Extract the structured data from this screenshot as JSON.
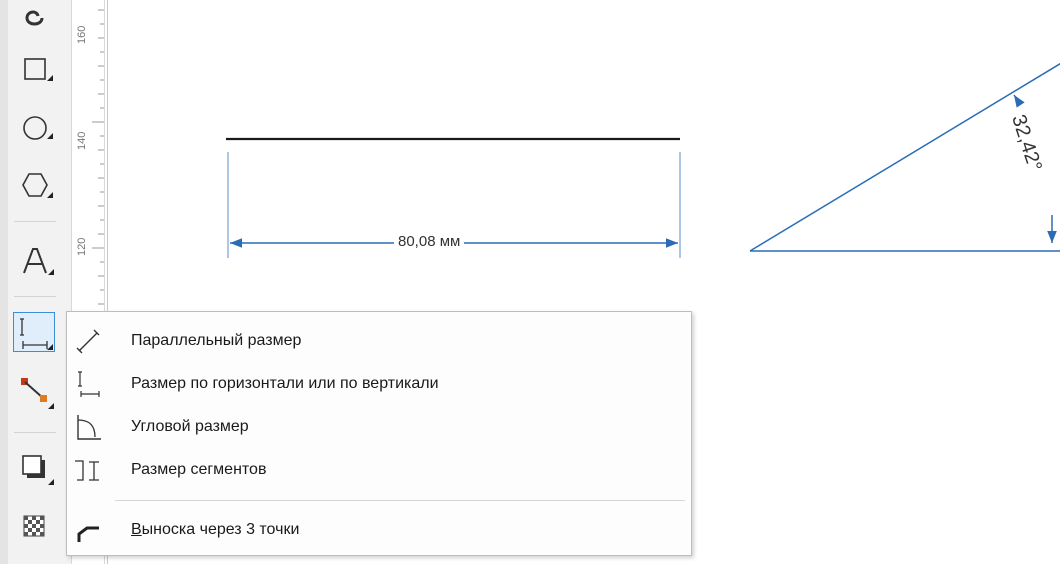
{
  "toolbox": {
    "tools": [
      {
        "name": "spiral-tool-icon"
      },
      {
        "name": "rectangle-tool-icon"
      },
      {
        "name": "ellipse-tool-icon"
      },
      {
        "name": "polygon-tool-icon"
      },
      {
        "name": "text-tool-icon"
      },
      {
        "name": "dimension-tool-icon",
        "active": true
      },
      {
        "name": "connector-tool-icon"
      },
      {
        "name": "drop-shadow-tool-icon"
      },
      {
        "name": "transparency-tool-icon"
      }
    ],
    "active_color": "#3b8fd6"
  },
  "ruler": {
    "labels": [
      "160",
      "140",
      "120"
    ]
  },
  "canvas": {
    "linear_dimension_text": "80,08 мм",
    "angular_dimension_text": "32,42°",
    "dimension_color": "#2a6db5",
    "line_color": "#1a1a1a"
  },
  "flyout_menu": {
    "items": [
      {
        "label": "Параллельный размер",
        "icon": "parallel-dimension-icon"
      },
      {
        "label": "Размер по горизонтали или по вертикали",
        "icon": "horizontal-vertical-dimension-icon"
      },
      {
        "label": "Угловой размер",
        "icon": "angular-dimension-icon"
      },
      {
        "label": "Размер сегментов",
        "icon": "segment-dimension-icon"
      }
    ],
    "callout": {
      "label_first": "В",
      "label_rest": "ыноска через 3 точки",
      "icon": "three-point-callout-icon"
    }
  }
}
